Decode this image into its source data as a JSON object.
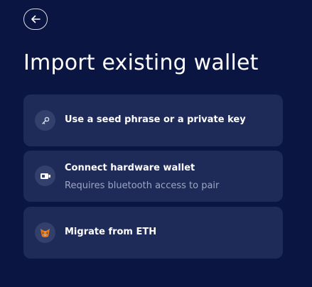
{
  "header": {
    "back_icon": "arrow-left-icon",
    "title": "Import existing wallet"
  },
  "options": [
    {
      "icon": "key-icon",
      "label": "Use a seed phrase or a private key"
    },
    {
      "icon": "hardware-wallet-icon",
      "label": "Connect hardware wallet",
      "sublabel": "Requires bluetooth access to pair"
    },
    {
      "icon": "metamask-fox-icon",
      "label": "Migrate from ETH"
    }
  ],
  "colors": {
    "background": "#0a1541",
    "card": "#1e2a58",
    "icon_circle": "#34406c",
    "secondary_text": "#9ea6c4"
  }
}
